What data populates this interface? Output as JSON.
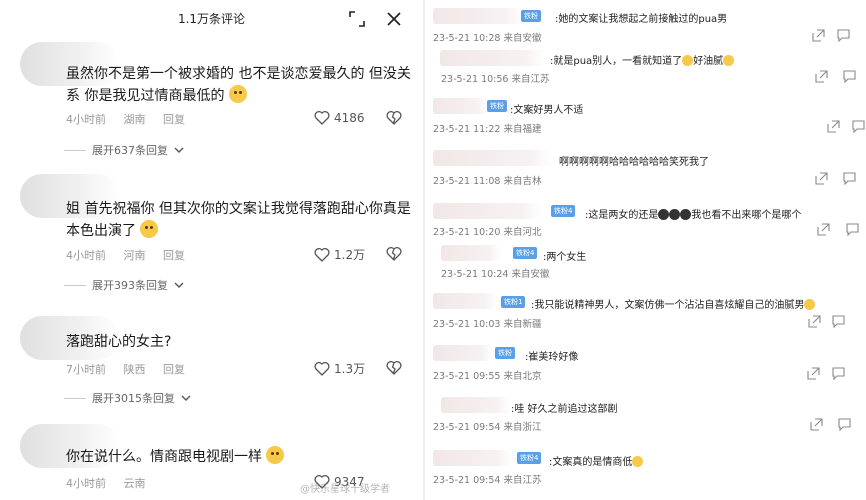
{
  "left": {
    "header_title": "1.1万条评论",
    "comments": [
      {
        "text": "虽然你不是第一个被求婚的 也不是谈恋爱最久的 但没关系 你是我见过情商最低的",
        "time": "4小时前",
        "location": "湖南",
        "reply": "回复",
        "likes": "4186",
        "more": "展开637条回复"
      },
      {
        "text": "姐 首先祝福你 但其次你的文案让我觉得落跑甜心你真是本色出演了",
        "time": "4小时前",
        "location": "河南",
        "reply": "回复",
        "likes": "1.2万",
        "more": "展开393条回复"
      },
      {
        "text": "落跑甜心的女主?",
        "time": "7小时前",
        "location": "陕西",
        "reply": "回复",
        "likes": "1.3万",
        "more": "展开3015条回复"
      },
      {
        "text": "你在说什么。情商跟电视剧一样",
        "time": "4小时前",
        "location": "云南",
        "reply": "回复",
        "likes": "9347",
        "more": ""
      }
    ]
  },
  "right": {
    "comments": [
      {
        "badge": "铁粉",
        "text": ":她的文案让我想起之前接触过的pua男",
        "meta": "23-5-21 10:28 来自安徽"
      },
      {
        "badge": "",
        "text": ":就是pua别人，一看就知道了",
        "meta": "23-5-21 10:56 来自江苏",
        "tail": "好油腻"
      },
      {
        "badge": "铁粉",
        "text": ":文案好男人不适",
        "meta": "23-5-21 11:22 来自福建"
      },
      {
        "badge": "",
        "text": "啊啊啊啊啊哈哈哈哈哈哈笑死我了",
        "meta": "23-5-21 11:08 来自吉林"
      },
      {
        "badge": "铁粉4",
        "text": ":这是两女的还是",
        "meta": "23-5-21 10:20 来自河北",
        "tail": "我也看不出来哪个是哪个"
      },
      {
        "badge": "铁粉4",
        "text": ":两个女生",
        "meta": "23-5-21 10:24 来自安徽"
      },
      {
        "badge": "铁粉1",
        "text": ":我只能说精神男人，文案仿佛一个沾沾自喜炫耀自己的油腻男",
        "meta": "23-5-21 10:03 来自新疆"
      },
      {
        "badge": "铁粉",
        "text": ":崔美玲好像",
        "meta": "23-5-21 09:55 来自北京"
      },
      {
        "badge": "",
        "text": ":哇 好久之前追过这部剧",
        "meta": "23-5-21 09:54 来自浙江"
      },
      {
        "badge": "铁粉4",
        "text": ":文案真的是情商低",
        "meta": "23-5-21 09:54 来自江苏"
      }
    ]
  },
  "watermark": "@快乐星球十级学者"
}
